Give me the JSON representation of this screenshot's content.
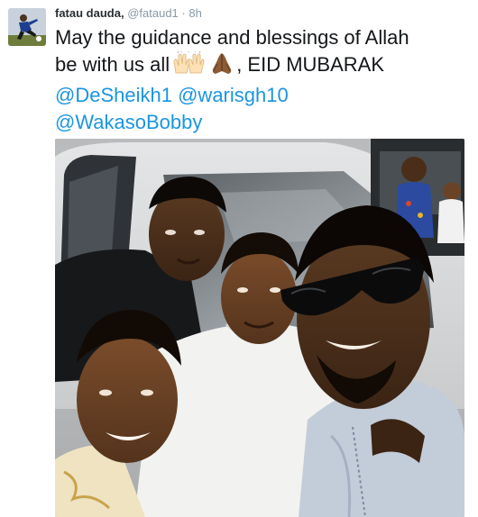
{
  "tweet": {
    "author_name": "fatau dauda,",
    "author_handle": "@fataud1",
    "separator": "·",
    "timestamp": "8h",
    "text_line1": "May the guidance and blessings of Allah",
    "text_line2_before": "be with us all",
    "text_line2_after": ", EID MUBARAK",
    "emojis": [
      "raised-hands-icon",
      "folded-hands-icon"
    ],
    "mentions": [
      "@DeSheikh1",
      "@warisgh10",
      "@WakasoBobby"
    ]
  },
  "colors": {
    "mention": "#1b95e0",
    "name": "#292f33",
    "meta": "#8899a6",
    "text": "#14171a"
  },
  "photo": {
    "subject": "group selfie of four men in front of a white car"
  }
}
